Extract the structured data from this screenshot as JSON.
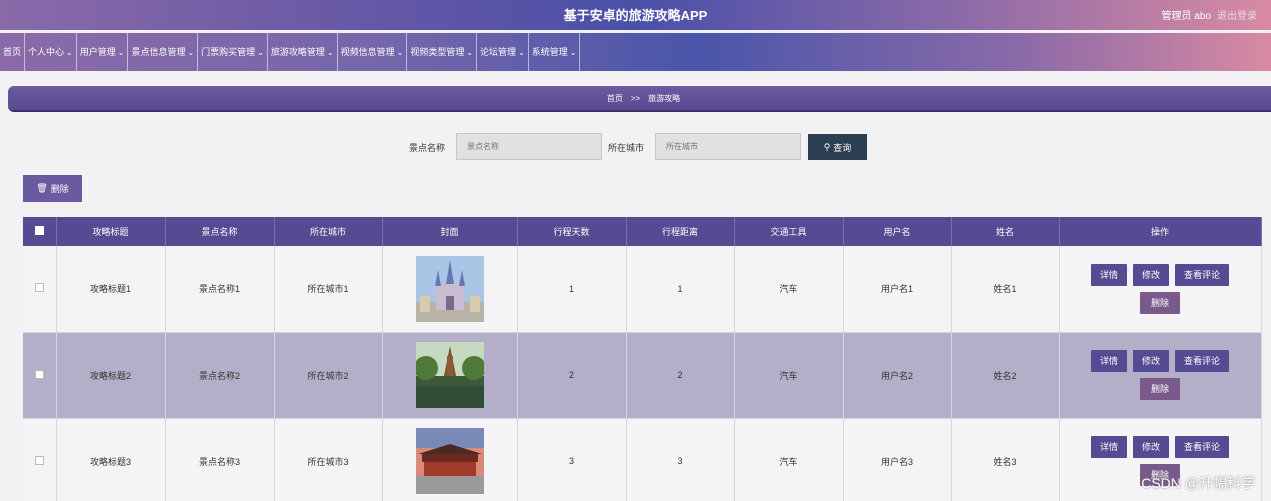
{
  "header": {
    "title": "基于安卓的旅游攻略APP",
    "admin": "管理员 abo",
    "logout": "退出登录"
  },
  "nav": {
    "items": [
      {
        "label": "首页",
        "dropdown": false
      },
      {
        "label": "个人中心",
        "dropdown": true
      },
      {
        "label": "用户管理",
        "dropdown": true
      },
      {
        "label": "景点信息管理",
        "dropdown": true
      },
      {
        "label": "门票购买管理",
        "dropdown": true
      },
      {
        "label": "旅游攻略管理",
        "dropdown": true
      },
      {
        "label": "视频信息管理",
        "dropdown": true
      },
      {
        "label": "视频类型管理",
        "dropdown": true
      },
      {
        "label": "论坛管理",
        "dropdown": true
      },
      {
        "label": "系统管理",
        "dropdown": true
      }
    ]
  },
  "breadcrumb": {
    "home": "首页",
    "sep": ">>",
    "current": "旅游攻略"
  },
  "search": {
    "spot_label": "景点名称",
    "spot_placeholder": "景点名称",
    "city_label": "所在城市",
    "city_placeholder": "所在城市",
    "button": "查询",
    "delete_button": "删除"
  },
  "table": {
    "headers": [
      "攻略标题",
      "景点名称",
      "所在城市",
      "封面",
      "行程天数",
      "行程距离",
      "交通工具",
      "用户名",
      "姓名",
      "操作"
    ],
    "actions": {
      "detail": "详情",
      "edit": "修改",
      "comments": "查看评论",
      "delete": "删除"
    },
    "rows": [
      {
        "title": "攻略标题1",
        "spot": "景点名称1",
        "city": "所在城市1",
        "days": "1",
        "distance": "1",
        "transport": "汽车",
        "username": "用户名1",
        "name": "姓名1",
        "cover": "castle"
      },
      {
        "title": "攻略标题2",
        "spot": "景点名称2",
        "city": "所在城市2",
        "days": "2",
        "distance": "2",
        "transport": "汽车",
        "username": "用户名2",
        "name": "姓名2",
        "cover": "pagoda-lake"
      },
      {
        "title": "攻略标题3",
        "spot": "景点名称3",
        "city": "所在城市3",
        "days": "3",
        "distance": "3",
        "transport": "汽车",
        "username": "用户名3",
        "name": "姓名3",
        "cover": "gate-sunset"
      }
    ]
  },
  "watermark": "CSDN @升幅科学"
}
